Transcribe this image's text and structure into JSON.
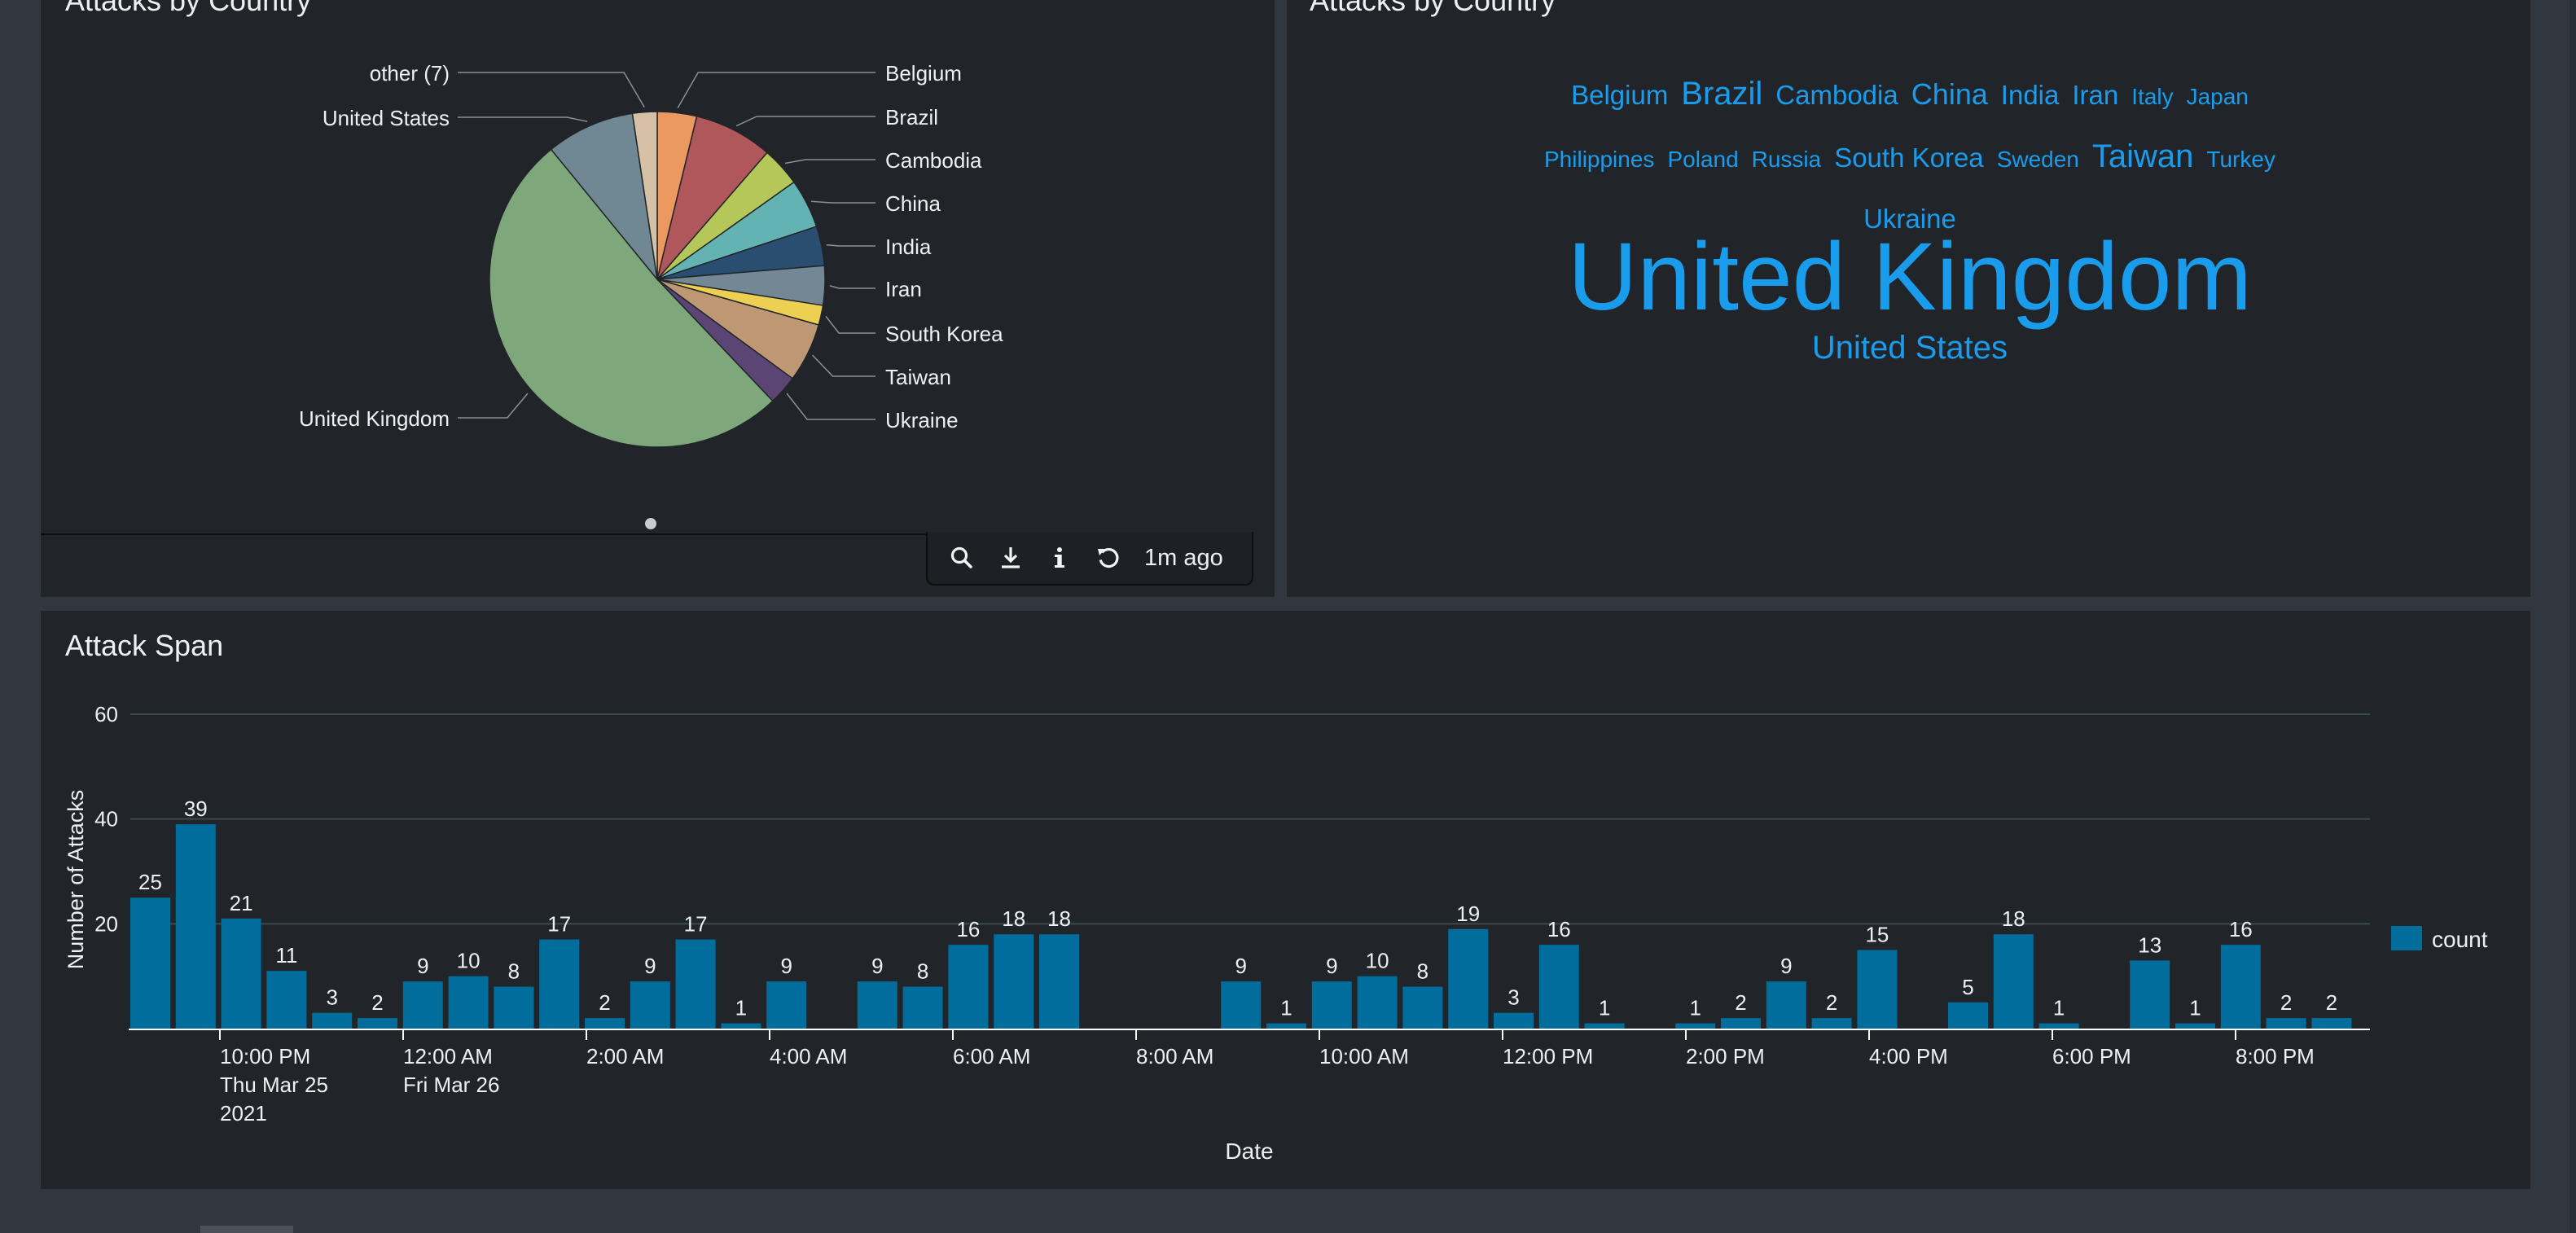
{
  "panels": {
    "pie_title": "Attacks by Country",
    "cloud_title": "Attacks by Country",
    "span_title": "Attack Span"
  },
  "toolbar": {
    "icons": [
      "search-icon",
      "download-icon",
      "info-icon",
      "refresh-icon"
    ],
    "updated": "1m ago"
  },
  "word_cloud": [
    {
      "word": "Belgium",
      "size": 1.5
    },
    {
      "word": "Brazil",
      "size": 2
    },
    {
      "word": "Cambodia",
      "size": 1.5
    },
    {
      "word": "China",
      "size": 1.7
    },
    {
      "word": "India",
      "size": 1.5
    },
    {
      "word": "Iran",
      "size": 1.5
    },
    {
      "word": "Italy",
      "size": 1
    },
    {
      "word": "Japan",
      "size": 1
    },
    {
      "word": "Philippines",
      "size": 1
    },
    {
      "word": "Poland",
      "size": 1
    },
    {
      "word": "Russia",
      "size": 1
    },
    {
      "word": "South Korea",
      "size": 1.5
    },
    {
      "word": "Sweden",
      "size": 1
    },
    {
      "word": "Taiwan",
      "size": 2
    },
    {
      "word": "Turkey",
      "size": 1
    },
    {
      "word": "Ukraine",
      "size": 1.5
    },
    {
      "word": "United Kingdom",
      "size": 5
    },
    {
      "word": "United States",
      "size": 2
    }
  ],
  "cloud_color": "#1a9cec",
  "chart_data": [
    {
      "type": "pie",
      "title": "Attacks by Country",
      "slices": [
        {
          "label": "Belgium",
          "value": 4,
          "color": "#ec9960"
        },
        {
          "label": "Brazil",
          "value": 8,
          "color": "#af575a"
        },
        {
          "label": "Cambodia",
          "value": 4,
          "color": "#b6c75a"
        },
        {
          "label": "China",
          "value": 5,
          "color": "#62b3b2"
        },
        {
          "label": "India",
          "value": 4,
          "color": "#294e70"
        },
        {
          "label": "Iran",
          "value": 4,
          "color": "#738795"
        },
        {
          "label": "South Korea",
          "value": 2,
          "color": "#edd051"
        },
        {
          "label": "Taiwan",
          "value": 6,
          "color": "#bd9872"
        },
        {
          "label": "Ukraine",
          "value": 3,
          "color": "#5a4575"
        },
        {
          "label": "United Kingdom",
          "value": 54,
          "color": "#7ea77b"
        },
        {
          "label": "United States",
          "value": 9,
          "color": "#708794"
        },
        {
          "label": "other (7)",
          "value": 2.5,
          "color": "#d6c1a7"
        }
      ]
    },
    {
      "type": "bar",
      "title": "Attack Span",
      "xlabel": "Date",
      "ylabel": "Number of Attacks",
      "ylim": [
        0,
        60
      ],
      "yticks": [
        20,
        40,
        60
      ],
      "legend": "count",
      "legend_position": "right",
      "color": "#006d9c",
      "x_tick_labels": [
        [
          "10:00 PM",
          "Thu Mar 25",
          "2021"
        ],
        [
          "12:00 AM",
          "Fri Mar 26"
        ],
        [
          "2:00 AM"
        ],
        [
          "4:00 AM"
        ],
        [
          "6:00 AM"
        ],
        [
          "8:00 AM"
        ],
        [
          "10:00 AM"
        ],
        [
          "12:00 PM"
        ],
        [
          "2:00 PM"
        ],
        [
          "4:00 PM"
        ],
        [
          "6:00 PM"
        ],
        [
          "8:00 PM"
        ]
      ],
      "series": [
        {
          "name": "count",
          "values": [
            25,
            39,
            21,
            11,
            3,
            2,
            9,
            10,
            8,
            17,
            2,
            9,
            17,
            1,
            9,
            null,
            9,
            8,
            16,
            18,
            18,
            null,
            null,
            null,
            9,
            1,
            9,
            10,
            8,
            19,
            3,
            16,
            1,
            null,
            1,
            2,
            9,
            2,
            15,
            null,
            5,
            18,
            1,
            null,
            13,
            1,
            16,
            2,
            2
          ]
        }
      ]
    }
  ]
}
